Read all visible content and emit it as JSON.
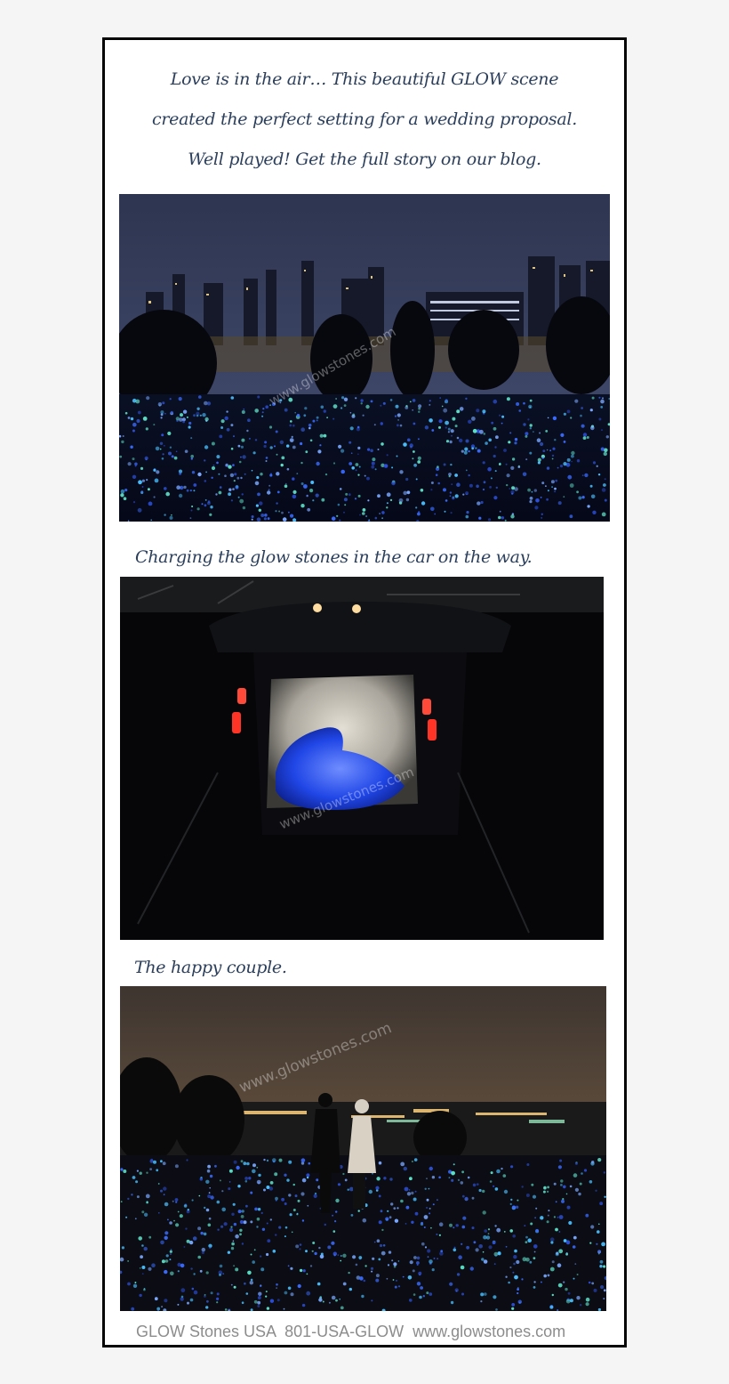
{
  "intro": {
    "line1": "Love is in the air… This beautiful GLOW scene",
    "line2": "created the perfect setting for a wedding  proposal.",
    "line3": "Well played!  Get the full story on our blog."
  },
  "captions": {
    "car": "Charging the glow stones in the car on the way.",
    "couple": "The happy couple."
  },
  "watermark": "www.glowstones.com",
  "footer": "GLOW Stones USA  801-USA-GLOW  www.glowstones.com",
  "colors": {
    "caption_text": "#2b3f5c",
    "glow_blue": "#3a6bff",
    "frame": "#050505"
  }
}
